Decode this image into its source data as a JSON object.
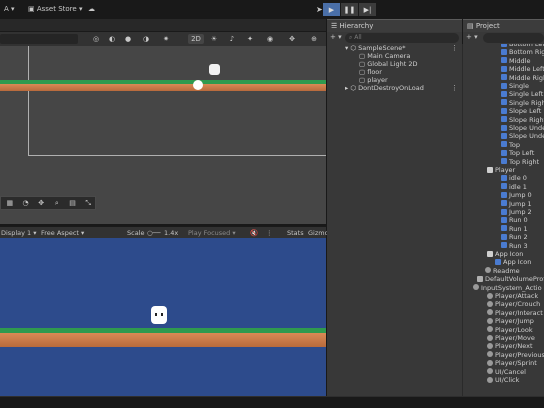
{
  "toolbar": {
    "account_label": "A",
    "asset_store_label": "Asset Store",
    "dropdown_caret": "▾",
    "cloud_icon": "☁",
    "play_icon": "▶",
    "pause_icon": "❚❚",
    "step_icon": "▶|"
  },
  "scene": {
    "tool_2d_label": "2D",
    "overlay_icons": [
      "palette-icon",
      "orbit-icon",
      "move-icon",
      "search-icon",
      "grid-icon",
      "snap-icon"
    ]
  },
  "game": {
    "display_label": "Display 1",
    "aspect_label": "Free Aspect",
    "scale_label": "Scale",
    "scale_value": "1.4x",
    "play_focused_label": "Play Focused",
    "stats_label": "Stats",
    "gizmos_label": "Gizmo"
  },
  "hierarchy": {
    "tab_label": "Hierarchy",
    "add_label": "+ ▾",
    "search_placeholder": "All",
    "rows": [
      {
        "label": "SampleScene*",
        "kind": "scene"
      },
      {
        "label": "Main Camera",
        "kind": "item"
      },
      {
        "label": "Global Light 2D",
        "kind": "item"
      },
      {
        "label": "floor",
        "kind": "item"
      },
      {
        "label": "player",
        "kind": "item"
      },
      {
        "label": "DontDestroyOnLoad",
        "kind": "scene"
      }
    ]
  },
  "project": {
    "tab_label": "Project",
    "add_label": "+ ▾",
    "rows": [
      {
        "label": "Bottom Left",
        "icon": "sprite-icon"
      },
      {
        "label": "Bottom Right",
        "icon": "sprite-icon"
      },
      {
        "label": "Middle",
        "icon": "sprite-icon"
      },
      {
        "label": "Middle Left",
        "icon": "sprite-icon"
      },
      {
        "label": "Middle Right",
        "icon": "sprite-icon"
      },
      {
        "label": "Single",
        "icon": "sprite-icon"
      },
      {
        "label": "Single Left",
        "icon": "sprite-icon"
      },
      {
        "label": "Single Right",
        "icon": "sprite-icon"
      },
      {
        "label": "Slope Left",
        "icon": "sprite-icon"
      },
      {
        "label": "Slope Right",
        "icon": "sprite-icon"
      },
      {
        "label": "Slope Under",
        "icon": "sprite-icon"
      },
      {
        "label": "Slope Under",
        "icon": "sprite-icon"
      },
      {
        "label": "Top",
        "icon": "sprite-icon"
      },
      {
        "label": "Top Left",
        "icon": "sprite-icon"
      },
      {
        "label": "Top Right",
        "icon": "sprite-icon"
      },
      {
        "label": "Player",
        "icon": "spritesheet-icon"
      },
      {
        "label": "idle 0",
        "icon": "sprite-icon"
      },
      {
        "label": "idle 1",
        "icon": "sprite-icon"
      },
      {
        "label": "Jump 0",
        "icon": "sprite-icon"
      },
      {
        "label": "Jump 1",
        "icon": "sprite-icon"
      },
      {
        "label": "Jump 2",
        "icon": "sprite-icon"
      },
      {
        "label": "Run 0",
        "icon": "sprite-icon"
      },
      {
        "label": "Run 1",
        "icon": "sprite-icon"
      },
      {
        "label": "Run 2",
        "icon": "sprite-icon"
      },
      {
        "label": "Run 3",
        "icon": "sprite-icon"
      },
      {
        "label": "App Icon",
        "icon": "spritesheet-icon"
      },
      {
        "label": "App Icon",
        "icon": "sprite-icon"
      },
      {
        "label": "Readme",
        "icon": "gameobject-icon"
      },
      {
        "label": "DefaultVolumeProfi",
        "icon": "file-icon"
      },
      {
        "label": "InputSystem_Actio",
        "icon": "gameobject-icon"
      },
      {
        "label": "Player/Attack",
        "icon": "gameobject-icon"
      },
      {
        "label": "Player/Crouch",
        "icon": "gameobject-icon"
      },
      {
        "label": "Player/Interact",
        "icon": "gameobject-icon"
      },
      {
        "label": "Player/Jump",
        "icon": "gameobject-icon"
      },
      {
        "label": "Player/Look",
        "icon": "gameobject-icon"
      },
      {
        "label": "Player/Move",
        "icon": "gameobject-icon"
      },
      {
        "label": "Player/Next",
        "icon": "gameobject-icon"
      },
      {
        "label": "Player/Previous",
        "icon": "gameobject-icon"
      },
      {
        "label": "Player/Sprint",
        "icon": "gameobject-icon"
      },
      {
        "label": "UI/Cancel",
        "icon": "gameobject-icon"
      },
      {
        "label": "UI/Click",
        "icon": "gameobject-icon"
      }
    ]
  }
}
